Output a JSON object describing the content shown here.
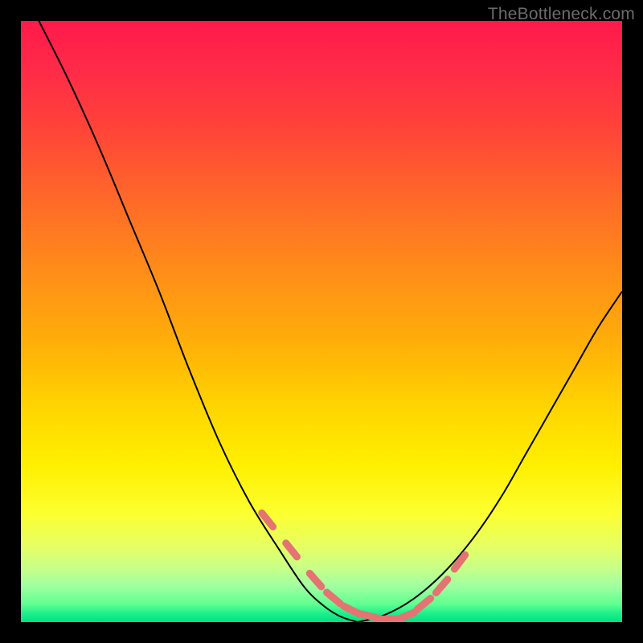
{
  "watermark": "TheBottleneck.com",
  "chart_data": {
    "type": "line",
    "title": "",
    "xlabel": "",
    "ylabel": "",
    "xlim": [
      0,
      100
    ],
    "ylim": [
      0,
      100
    ],
    "grid": false,
    "legend": false,
    "series": [
      {
        "name": "left-curve",
        "x": [
          3,
          8,
          13,
          18,
          23,
          28,
          33,
          38,
          43,
          47,
          50,
          53,
          56
        ],
        "y": [
          100,
          90,
          79,
          67,
          55,
          42,
          30,
          20,
          12,
          6,
          3,
          1,
          0
        ]
      },
      {
        "name": "right-curve",
        "x": [
          56,
          60,
          64,
          68,
          72,
          76,
          80,
          84,
          88,
          92,
          96,
          100
        ],
        "y": [
          0,
          1,
          3,
          6,
          10,
          15,
          21,
          28,
          35,
          42,
          49,
          55
        ]
      },
      {
        "name": "highlight-dashes",
        "x": [
          41,
          45,
          49,
          52,
          55,
          58,
          61,
          64,
          67,
          70,
          73
        ],
        "y": [
          17,
          12,
          7,
          4,
          2,
          1,
          0.5,
          1,
          3,
          6,
          10
        ]
      }
    ],
    "colors": {
      "curve": "#000000",
      "highlight": "#e57373",
      "background_top": "#ff1a4a",
      "background_bottom": "#00e080"
    }
  }
}
